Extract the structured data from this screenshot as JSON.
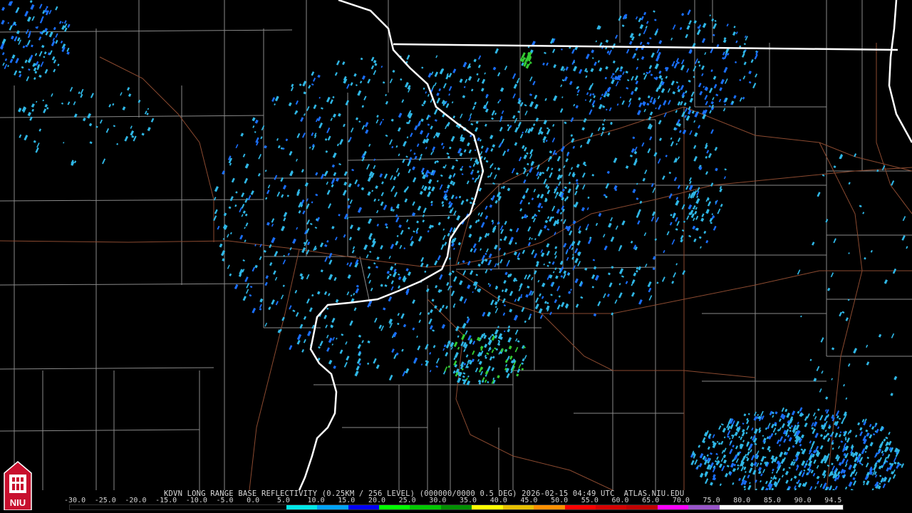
{
  "caption": "KDVN LONG RANGE BASE REFLECTIVITY (0.25KM / 256 LEVEL) (000000/0000 0.5 DEG) 2026-02-15 04:49 UTC  ATLAS.NIU.EDU",
  "logo_text": "NIU",
  "scale": {
    "unit_ticks": [
      "-30.0",
      "-25.0",
      "-20.0",
      "-15.0",
      "-10.0",
      "-5.0",
      "0.0",
      "5.0",
      "10.0",
      "15.0",
      "20.0",
      "25.0",
      "30.0",
      "35.0",
      "40.0",
      "45.0",
      "50.0",
      "55.0",
      "60.0",
      "65.0",
      "70.0",
      "75.0",
      "80.0",
      "85.0",
      "90.0",
      "94.5"
    ],
    "colors": [
      "#000000",
      "#000000",
      "#000000",
      "#000000",
      "#000000",
      "#000000",
      "#000000",
      "#00e8e8",
      "#00a2f6",
      "#0000f6",
      "#00ff00",
      "#00c800",
      "#009000",
      "#ffff00",
      "#e7c000",
      "#ff9000",
      "#ff0000",
      "#d60000",
      "#c00000",
      "#ff00ff",
      "#9955c9",
      "#ffffff",
      "#ffffff",
      "#ffffff",
      "#ffffff"
    ]
  },
  "map_colors": {
    "state_border": "#ffffff",
    "county_border": "#8a8a8a",
    "highway": "#8b4a30",
    "echo_low": "#2fb7e6",
    "echo_mid": "#1a6fff",
    "echo_green": "#33cc33"
  }
}
